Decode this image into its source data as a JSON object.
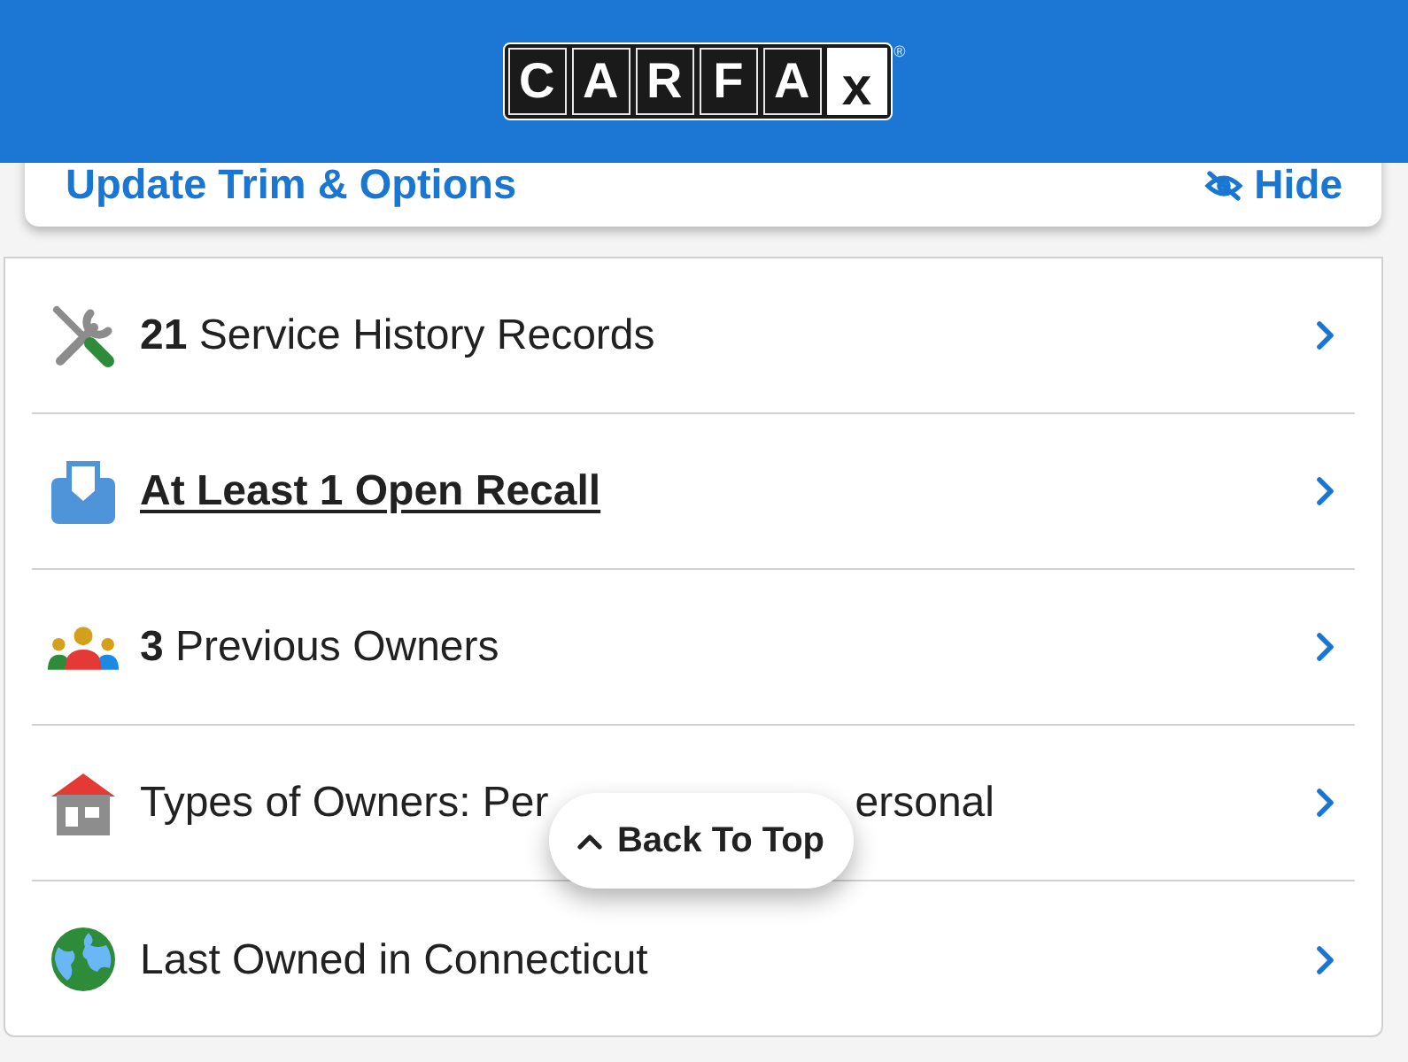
{
  "header": {
    "logo": {
      "letters": [
        {
          "char": "C",
          "kind": "dark"
        },
        {
          "char": "A",
          "kind": "dark"
        },
        {
          "char": "R",
          "kind": "dark"
        },
        {
          "char": "F",
          "kind": "dark"
        },
        {
          "char": "A",
          "kind": "dark"
        },
        {
          "char": "x",
          "kind": "light"
        }
      ],
      "registered": "®"
    }
  },
  "trim_card": {
    "link": "Update Trim & Options",
    "hide_button": "Hide"
  },
  "history": {
    "rows": [
      {
        "kind": "plain",
        "text": "**21** Service History Records"
      },
      {
        "kind": "link",
        "text": "At Least 1 Open Recall"
      },
      {
        "kind": "plain",
        "text": "**3** Previous Owners"
      },
      {
        "kind": "plain",
        "text": "Types of Owners: Per",
        "text_after": "ersonal"
      },
      {
        "kind": "plain",
        "text": "Last Owned in Connecticut"
      }
    ]
  },
  "back_to_top": {
    "label": "Back To Top"
  }
}
